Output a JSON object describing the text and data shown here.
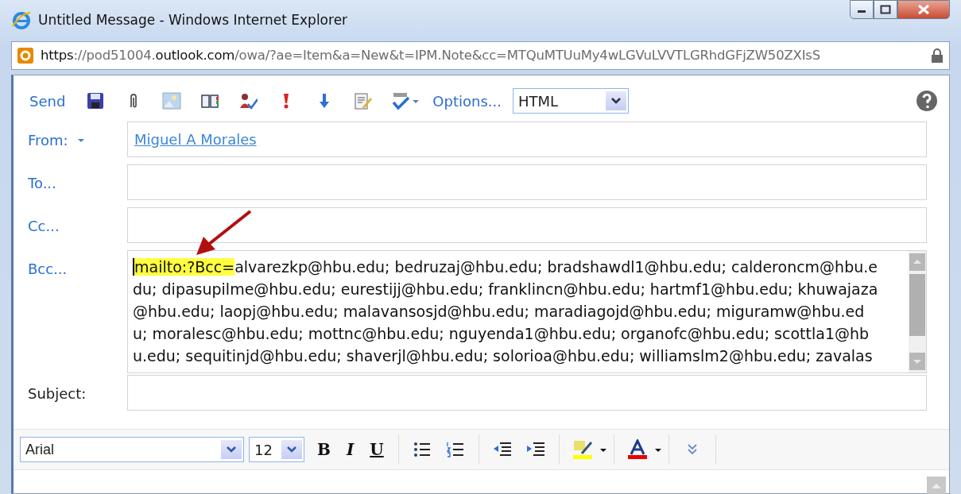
{
  "window": {
    "title": "Untitled Message - Windows Internet Explorer"
  },
  "address_bar": {
    "url_parts": [
      {
        "text": "https",
        "strong": true
      },
      {
        "text": "://pod51004.",
        "strong": false
      },
      {
        "text": "outlook.com",
        "strong": true
      },
      {
        "text": "/owa/?ae=Item&a=New&t=IPM.Note&cc=MTQuMTUuMy4wLGVuLVVTLGRhdGFjZW50ZXIsS",
        "strong": false
      }
    ]
  },
  "toolbar": {
    "send": "Send",
    "options": "Options...",
    "format": "HTML"
  },
  "fields": [
    {
      "kind": "from",
      "label": "From:",
      "value": "Miguel A Morales"
    },
    {
      "kind": "plain",
      "label": "To..."
    },
    {
      "kind": "plain",
      "label": "Cc..."
    },
    {
      "kind": "bcc",
      "label": "Bcc...",
      "highlight": "mailto:?Bcc=",
      "lines": [
        "alvarezkp@hbu.edu; bedruzaj@hbu.edu; bradshawdl1@hbu.edu; calderoncm@hbu.e",
        "du; dipasupilme@hbu.edu; eurestijj@hbu.edu; franklincn@hbu.edu; hartmf1@hbu.edu; khuwajaza",
        "@hbu.edu; laopj@hbu.edu; malavansosjd@hbu.edu; maradiagojd@hbu.edu; miguramw@hbu.ed",
        "u; moralesc@hbu.edu; mottnc@hbu.edu; nguyenda1@hbu.edu; organofc@hbu.edu; scottla1@hb",
        "u.edu; sequitinjd@hbu.edu; shaverjl@hbu.edu; solorioa@hbu.edu; williamslm2@hbu.edu; zavalas"
      ]
    },
    {
      "kind": "subject",
      "label": "Subject:"
    }
  ],
  "format_bar": {
    "font": "Arial",
    "size": "12",
    "bold": "B",
    "italic": "I",
    "underline": "U"
  }
}
